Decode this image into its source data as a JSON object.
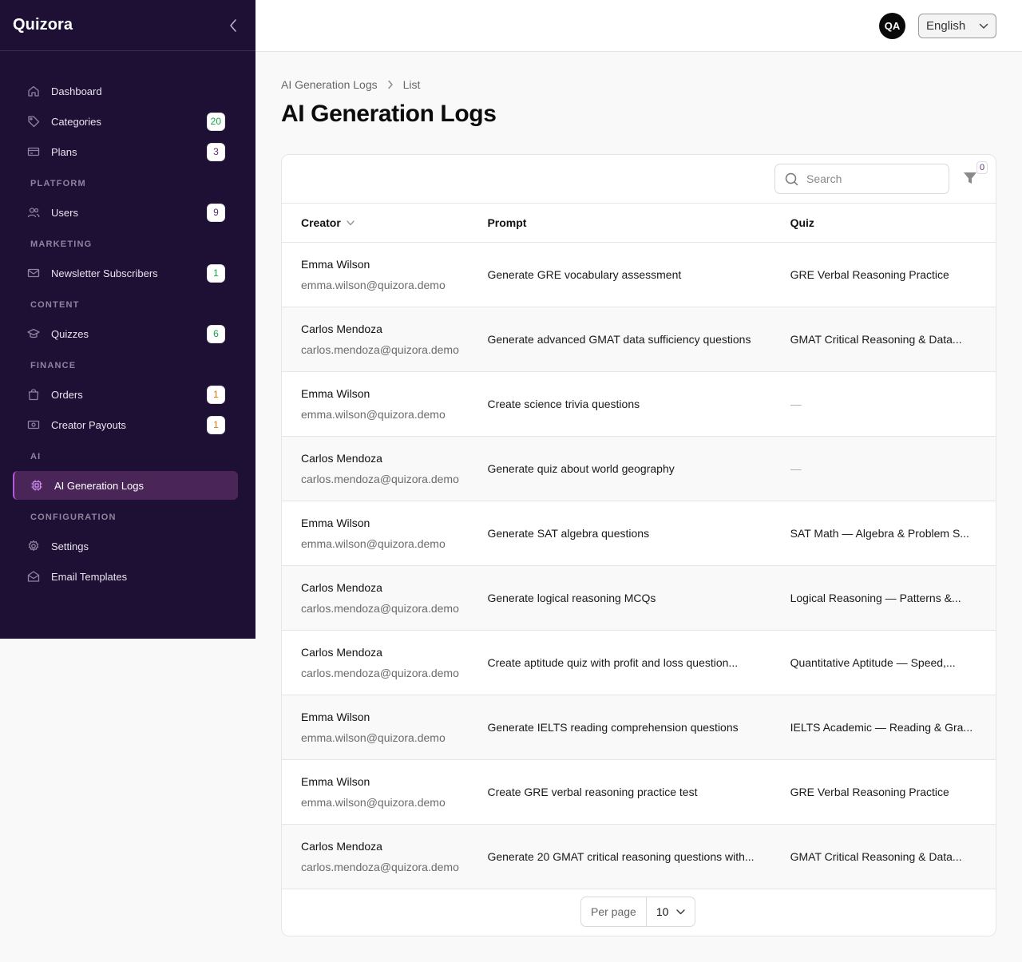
{
  "app": {
    "brand": "Quizora"
  },
  "header": {
    "avatar_initials": "QA",
    "language": "English"
  },
  "sidebar": {
    "items": [
      {
        "label": "Dashboard",
        "icon": "home-icon"
      },
      {
        "label": "Categories",
        "icon": "tag-icon",
        "badge": "20",
        "badge_color": "#16a34a"
      },
      {
        "label": "Plans",
        "icon": "credit-card-icon",
        "badge": "3",
        "badge_color": "#5b2a72"
      }
    ],
    "sections": [
      {
        "label": "PLATFORM",
        "items": [
          {
            "label": "Users",
            "icon": "users-icon",
            "badge": "9",
            "badge_color": "#5b2a72"
          }
        ]
      },
      {
        "label": "MARKETING",
        "items": [
          {
            "label": "Newsletter Subscribers",
            "icon": "mail-icon",
            "badge": "1",
            "badge_color": "#16a34a"
          }
        ]
      },
      {
        "label": "CONTENT",
        "items": [
          {
            "label": "Quizzes",
            "icon": "graduation-cap-icon",
            "badge": "6",
            "badge_color": "#16a34a"
          }
        ]
      },
      {
        "label": "FINANCE",
        "items": [
          {
            "label": "Orders",
            "icon": "shopping-bag-icon",
            "badge": "1",
            "badge_color": "#d97706"
          },
          {
            "label": "Creator Payouts",
            "icon": "banknote-icon",
            "badge": "1",
            "badge_color": "#d97706"
          }
        ]
      },
      {
        "label": "AI",
        "items": [
          {
            "label": "AI Generation Logs",
            "icon": "cpu-chip-icon",
            "active": true
          }
        ]
      },
      {
        "label": "CONFIGURATION",
        "items": [
          {
            "label": "Settings",
            "icon": "gear-icon"
          },
          {
            "label": "Email Templates",
            "icon": "envelope-open-icon"
          }
        ]
      }
    ]
  },
  "breadcrumb": {
    "parent": "AI Generation Logs",
    "current": "List"
  },
  "page": {
    "title": "AI Generation Logs"
  },
  "table": {
    "search_placeholder": "Search",
    "filter_count": "0",
    "columns": {
      "creator": "Creator",
      "prompt": "Prompt",
      "quiz": "Quiz"
    },
    "rows": [
      {
        "name": "Emma Wilson",
        "email": "emma.wilson@quizora.demo",
        "prompt": "Generate GRE vocabulary assessment",
        "quiz": "GRE Verbal Reasoning Practice"
      },
      {
        "name": "Carlos Mendoza",
        "email": "carlos.mendoza@quizora.demo",
        "prompt": "Generate advanced GMAT data sufficiency questions",
        "quiz": "GMAT Critical Reasoning & Data..."
      },
      {
        "name": "Emma Wilson",
        "email": "emma.wilson@quizora.demo",
        "prompt": "Create science trivia questions",
        "quiz": "—"
      },
      {
        "name": "Carlos Mendoza",
        "email": "carlos.mendoza@quizora.demo",
        "prompt": "Generate quiz about world geography",
        "quiz": "—"
      },
      {
        "name": "Emma Wilson",
        "email": "emma.wilson@quizora.demo",
        "prompt": "Generate SAT algebra questions",
        "quiz": "SAT Math — Algebra & Problem S..."
      },
      {
        "name": "Carlos Mendoza",
        "email": "carlos.mendoza@quizora.demo",
        "prompt": "Generate logical reasoning MCQs",
        "quiz": "Logical Reasoning — Patterns &..."
      },
      {
        "name": "Carlos Mendoza",
        "email": "carlos.mendoza@quizora.demo",
        "prompt": "Create aptitude quiz with profit and loss question...",
        "quiz": "Quantitative Aptitude — Speed,..."
      },
      {
        "name": "Emma Wilson",
        "email": "emma.wilson@quizora.demo",
        "prompt": "Generate IELTS reading comprehension questions",
        "quiz": "IELTS Academic — Reading & Gra..."
      },
      {
        "name": "Emma Wilson",
        "email": "emma.wilson@quizora.demo",
        "prompt": "Create GRE verbal reasoning practice test",
        "quiz": "GRE Verbal Reasoning Practice"
      },
      {
        "name": "Carlos Mendoza",
        "email": "carlos.mendoza@quizora.demo",
        "prompt": "Generate 20 GMAT critical reasoning questions with...",
        "quiz": "GMAT Critical Reasoning & Data..."
      }
    ]
  },
  "pagination": {
    "per_page_label": "Per page",
    "per_page_value": "10"
  }
}
